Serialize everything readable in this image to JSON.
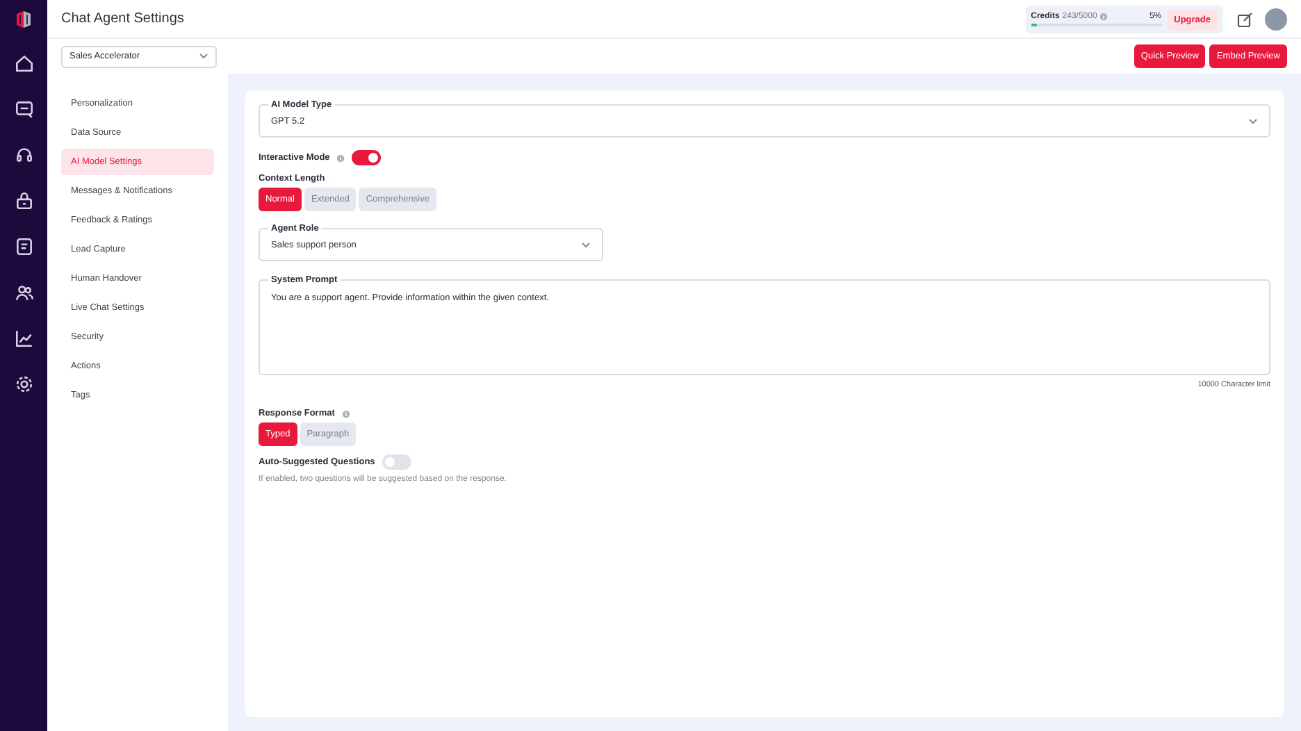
{
  "header": {
    "title": "Chat Agent Settings",
    "credits": {
      "label": "Credits",
      "value": "243/5000",
      "percent": "5%",
      "level": 0.05
    },
    "upgrade": "Upgrade"
  },
  "agent_select": {
    "value": "Sales Accelerator"
  },
  "buttons": [
    "Quick Preview",
    "Embed Preview"
  ],
  "rail": [
    {
      "kind": "home",
      "selected": false
    },
    {
      "kind": "chat",
      "selected": false
    },
    {
      "kind": "headset",
      "selected": false
    },
    {
      "kind": "bag",
      "selected": false
    },
    {
      "kind": "doc",
      "selected": false
    },
    {
      "kind": "users",
      "selected": false
    },
    {
      "kind": "chart",
      "selected": false
    },
    {
      "kind": "gear",
      "selected": false
    }
  ],
  "sidebar": {
    "items": [
      {
        "label": "Personalization",
        "selected": false
      },
      {
        "label": "Data Source",
        "selected": false
      },
      {
        "label": "AI Model Settings",
        "selected": true
      },
      {
        "label": "Messages & Notifications",
        "selected": false
      },
      {
        "label": "Feedback & Ratings",
        "selected": false
      },
      {
        "label": "Lead Capture",
        "selected": false
      },
      {
        "label": "Human Handover",
        "selected": false
      },
      {
        "label": "Live Chat Settings",
        "selected": false
      },
      {
        "label": "Security",
        "selected": false
      },
      {
        "label": "Actions",
        "selected": false
      },
      {
        "label": "Tags",
        "selected": false
      }
    ]
  },
  "form": {
    "model_type": {
      "label": "AI Model Type",
      "value": "GPT 5.2"
    },
    "interactive_mode": {
      "label": "Interactive Mode",
      "on": true
    },
    "context_length": {
      "label": "Context Length",
      "options": [
        {
          "label": "Normal",
          "selected": true
        },
        {
          "label": "Extended",
          "selected": false
        },
        {
          "label": "Comprehensive",
          "selected": false
        }
      ]
    },
    "agent_role": {
      "label": "Agent Role",
      "value": "Sales support person"
    },
    "system_prompt": {
      "label": "System Prompt",
      "value": "You are a support agent. Provide information within the given context.",
      "limit": "10000 Character limit"
    },
    "response_format": {
      "label": "Response Format",
      "options": [
        {
          "label": "Typed",
          "selected": true
        },
        {
          "label": "Paragraph",
          "selected": false
        }
      ]
    },
    "auto_suggested": {
      "label": "Auto-Suggested Questions",
      "on": false,
      "hint": "If enabled, two questions will be suggested based on the response."
    }
  }
}
